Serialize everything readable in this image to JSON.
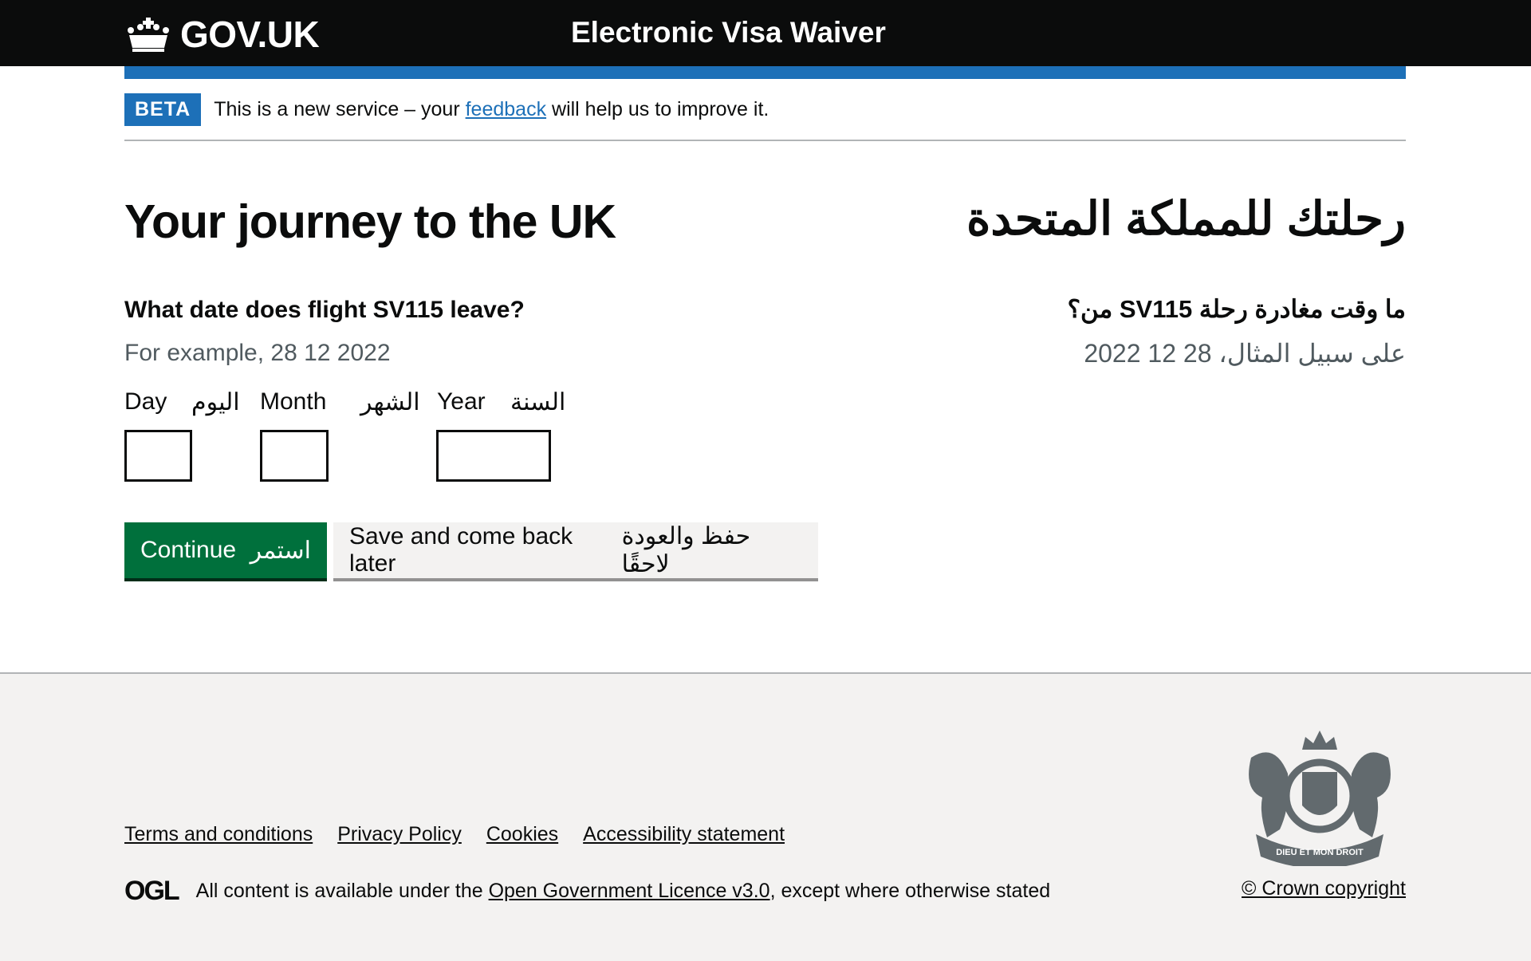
{
  "header": {
    "logo_text": "GOV.UK",
    "service_name": "Electronic Visa Waiver"
  },
  "phase_banner": {
    "tag": "BETA",
    "text_before": "This is a new service – your ",
    "link": "feedback",
    "text_after": " will help us to improve it."
  },
  "main": {
    "title": "Your journey to the UK",
    "title_ar": "رحلتك للمملكة المتحدة",
    "question": "What date does flight SV115 leave?",
    "question_ar": "ما وقت مغادرة رحلة SV115 من؟",
    "hint": "For example, 28 12 2022",
    "hint_ar": "على سبيل المثال، 28 12 2022",
    "fields": [
      {
        "label": "Day",
        "label_ar": "اليوم",
        "value": ""
      },
      {
        "label": "Month",
        "label_ar": "الشهر",
        "value": ""
      },
      {
        "label": "Year",
        "label_ar": "السنة",
        "value": ""
      }
    ],
    "continue": {
      "label": "Continue",
      "label_ar": "استمر"
    },
    "save": {
      "label": "Save and come back later",
      "label_ar": "حفظ والعودة لاحقًا"
    }
  },
  "footer": {
    "links": [
      "Terms and conditions",
      "Privacy Policy",
      "Cookies",
      "Accessibility statement"
    ],
    "ogl_logo": "OGL",
    "licence_before": "All content is available under the ",
    "licence_link": "Open Government Licence v3.0",
    "licence_after": ", except where otherwise stated",
    "copyright": "© Crown copyright",
    "crest_motto": "DIEU ET MON DROIT"
  },
  "colors": {
    "header": "#0b0c0c",
    "accent": "#1d70b8",
    "button": "#00703c",
    "footer": "#f3f2f1"
  }
}
